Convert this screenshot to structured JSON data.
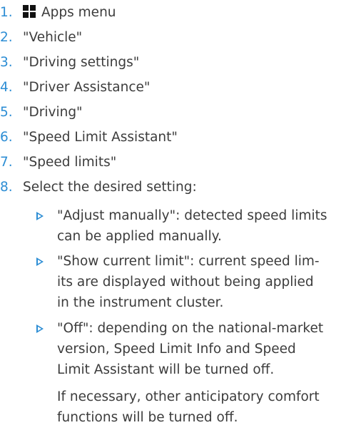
{
  "steps": [
    {
      "num": "1.",
      "text": "Apps menu",
      "icon": "apps-grid-icon"
    },
    {
      "num": "2.",
      "text": "\"Vehicle\""
    },
    {
      "num": "3.",
      "text": "\"Driving settings\""
    },
    {
      "num": "4.",
      "text": "\"Driver Assistance\""
    },
    {
      "num": "5.",
      "text": "\"Driving\""
    },
    {
      "num": "6.",
      "text": "\"Speed Limit Assistant\""
    },
    {
      "num": "7.",
      "text": "\"Speed limits\""
    },
    {
      "num": "8.",
      "text": "Select the desired setting:"
    }
  ],
  "options": [
    {
      "line1": "\"Adjust manually\": detected speed limits",
      "line2": "can be applied manually."
    },
    {
      "line1": "\"Show current limit\": current speed lim-",
      "line2": "its are displayed without being applied",
      "line3": "in the instrument cluster."
    },
    {
      "line1": "\"Off\": depending on the national-market",
      "line2": "version, Speed Limit Info and Speed",
      "line3": "Limit Assistant will be turned off."
    }
  ],
  "note": {
    "line1": "If necessary, other anticipatory comfort",
    "line2": "functions will be turned off."
  },
  "colors": {
    "accent": "#2c8dd4",
    "text": "#3c3c3c"
  }
}
